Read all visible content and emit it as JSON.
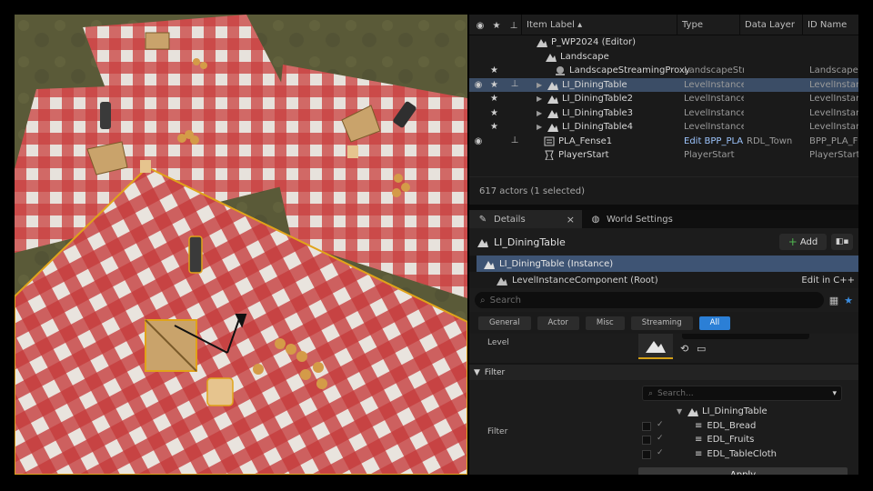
{
  "outliner": {
    "columns": {
      "item_label": "Item Label ▴",
      "type": "Type",
      "data_layer": "Data Layer",
      "id_name": "ID Name"
    },
    "rows": [
      {
        "label": "P_WP2024 (Editor)",
        "type": "",
        "layer": "",
        "id": ""
      },
      {
        "label": "Landscape",
        "type": "",
        "layer": "",
        "id": ""
      },
      {
        "label": "LandscapeStreamingProxy",
        "type": "LandscapeStr",
        "layer": "",
        "id": "LandscapeS"
      },
      {
        "label": "LI_DiningTable",
        "type": "LevelInstance",
        "layer": "",
        "id": "LevelInstance"
      },
      {
        "label": "LI_DiningTable2",
        "type": "LevelInstance",
        "layer": "",
        "id": "LevelInstance"
      },
      {
        "label": "LI_DiningTable3",
        "type": "LevelInstance",
        "layer": "",
        "id": "LevelInstance"
      },
      {
        "label": "LI_DiningTable4",
        "type": "LevelInstance",
        "layer": "",
        "id": "LevelInstance"
      },
      {
        "label": "PLA_Fense1",
        "type": "Edit BPP_PLA",
        "layer": "RDL_Town",
        "id": "BPP_PLA_F"
      },
      {
        "label": "PlayerStart",
        "type": "PlayerStart",
        "layer": "",
        "id": "PlayerStart_"
      }
    ],
    "actor_count": "617 actors (1 selected)"
  },
  "tabs": {
    "details": "Details",
    "world_settings": "World Settings",
    "close": "×"
  },
  "details": {
    "title": "LI_DiningTable",
    "add_label": "Add",
    "instance_label": "LI_DiningTable (Instance)",
    "root_component": "LevelInstanceComponent (Root)",
    "edit_cpp": "Edit in C++",
    "search_placeholder": "Search",
    "filters": [
      "General",
      "Actor",
      "Misc",
      "Streaming",
      "All"
    ],
    "level_label": "Level",
    "section_filter": "Filter",
    "filter_label": "Filter",
    "filter_search_placeholder": "Search...",
    "tree_root": "LI_DiningTable",
    "layers": [
      "EDL_Bread",
      "EDL_Fruits",
      "EDL_TableCloth"
    ],
    "apply_label": "Apply"
  },
  "colors": {
    "selection": "#3b4d66",
    "accent_blue": "#2b7fd6",
    "tablecloth_red": "#c23a3a",
    "selection_outline": "#e0a31a"
  }
}
